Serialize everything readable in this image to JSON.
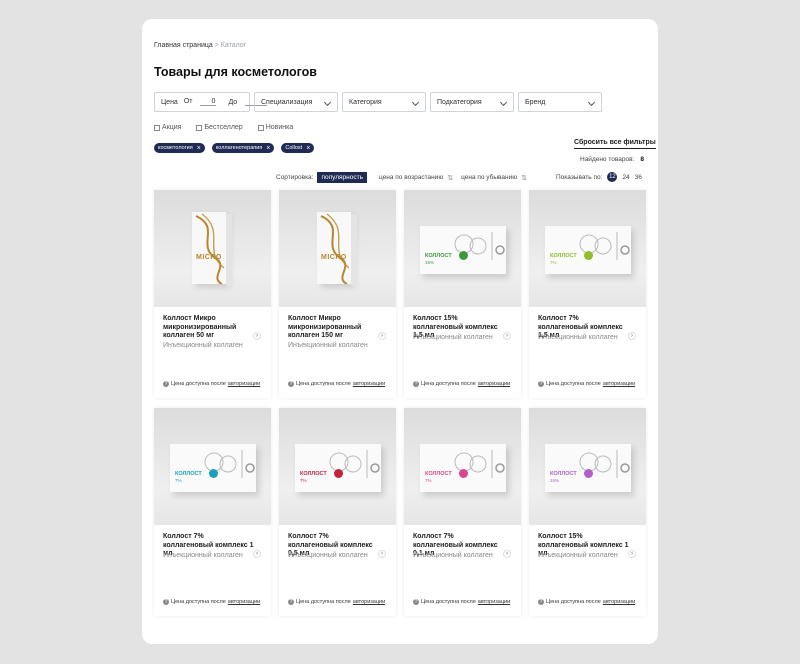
{
  "breadcrumbs": {
    "home": "Главная страница",
    "separator": ">",
    "current": "Каталог"
  },
  "page_title": "Товары для косметологов",
  "filters": {
    "price_label": "Цена",
    "from_label": "От",
    "from_value": "0",
    "to_label": "До",
    "specialization": "Специализация",
    "category": "Категория",
    "subcategory": "Подкатегория",
    "brand": "Бренд"
  },
  "checkboxes": [
    "Акция",
    "Бестселлер",
    "Новинка"
  ],
  "reset_label": "Сбросить все фильтры",
  "active_tags": [
    "косметология",
    "коллагенотерапия",
    "Collost"
  ],
  "found": {
    "label": "Найдено товаров:",
    "count": "8"
  },
  "sort": {
    "label": "Сортировка:",
    "active": "популярность",
    "asc": "цена по возрастанию",
    "desc": "цена по убыванию"
  },
  "per_page": {
    "label": "Показывать по:",
    "options": [
      "12",
      "24",
      "36"
    ],
    "selected": "12"
  },
  "products": [
    {
      "name": "Коллост Микро микронизированный коллаген 50 мг",
      "type": "Инъекционный коллаген",
      "box": "tall",
      "box_label": "MICRO",
      "accent": "#b8862e"
    },
    {
      "name": "Коллост Микро микронизированный коллаген 150 мг",
      "type": "Инъекционный коллаген",
      "box": "tall",
      "box_label": "MICRO",
      "accent": "#b8862e"
    },
    {
      "name": "Коллост 15% коллагеновый комплекс 1,5 мл",
      "type": "Инъекционный коллаген",
      "box": "wide",
      "box_label": "КОЛЛОСТ",
      "box_pct": "15%",
      "accent": "#3a9a3a"
    },
    {
      "name": "Коллост 7% коллагеновый комплекс 1,5 мл",
      "type": "Инъекционный коллаген",
      "box": "wide",
      "box_label": "КОЛЛОСТ",
      "box_pct": "7%",
      "accent": "#8cbf2a"
    },
    {
      "name": "Коллост 7% коллагеновый комплекс 1 мл",
      "type": "Инъекционный коллаген",
      "box": "wide",
      "box_label": "КОЛЛОСТ",
      "box_pct": "7%",
      "accent": "#1aa0b8"
    },
    {
      "name": "Коллост 7% коллагеновый комплекс 0,5 мл",
      "type": "Инъекционный коллаген",
      "box": "wide",
      "box_label": "КОЛЛОСТ",
      "box_pct": "7%",
      "accent": "#c2223a"
    },
    {
      "name": "Коллост 7% коллагеновый комплекс 0,1 мл",
      "type": "Инъекционный коллаген",
      "box": "wide",
      "box_label": "КОЛЛОСТ",
      "box_pct": "7%",
      "accent": "#d8488a"
    },
    {
      "name": "Коллост 15% коллагеновый комплекс 1 мл",
      "type": "Инъекционный коллаген",
      "box": "wide",
      "box_label": "КОЛЛОСТ",
      "box_pct": "15%",
      "accent": "#b060c8"
    }
  ],
  "price_note": {
    "text": "Цена доступна после",
    "link": "авторизации"
  }
}
